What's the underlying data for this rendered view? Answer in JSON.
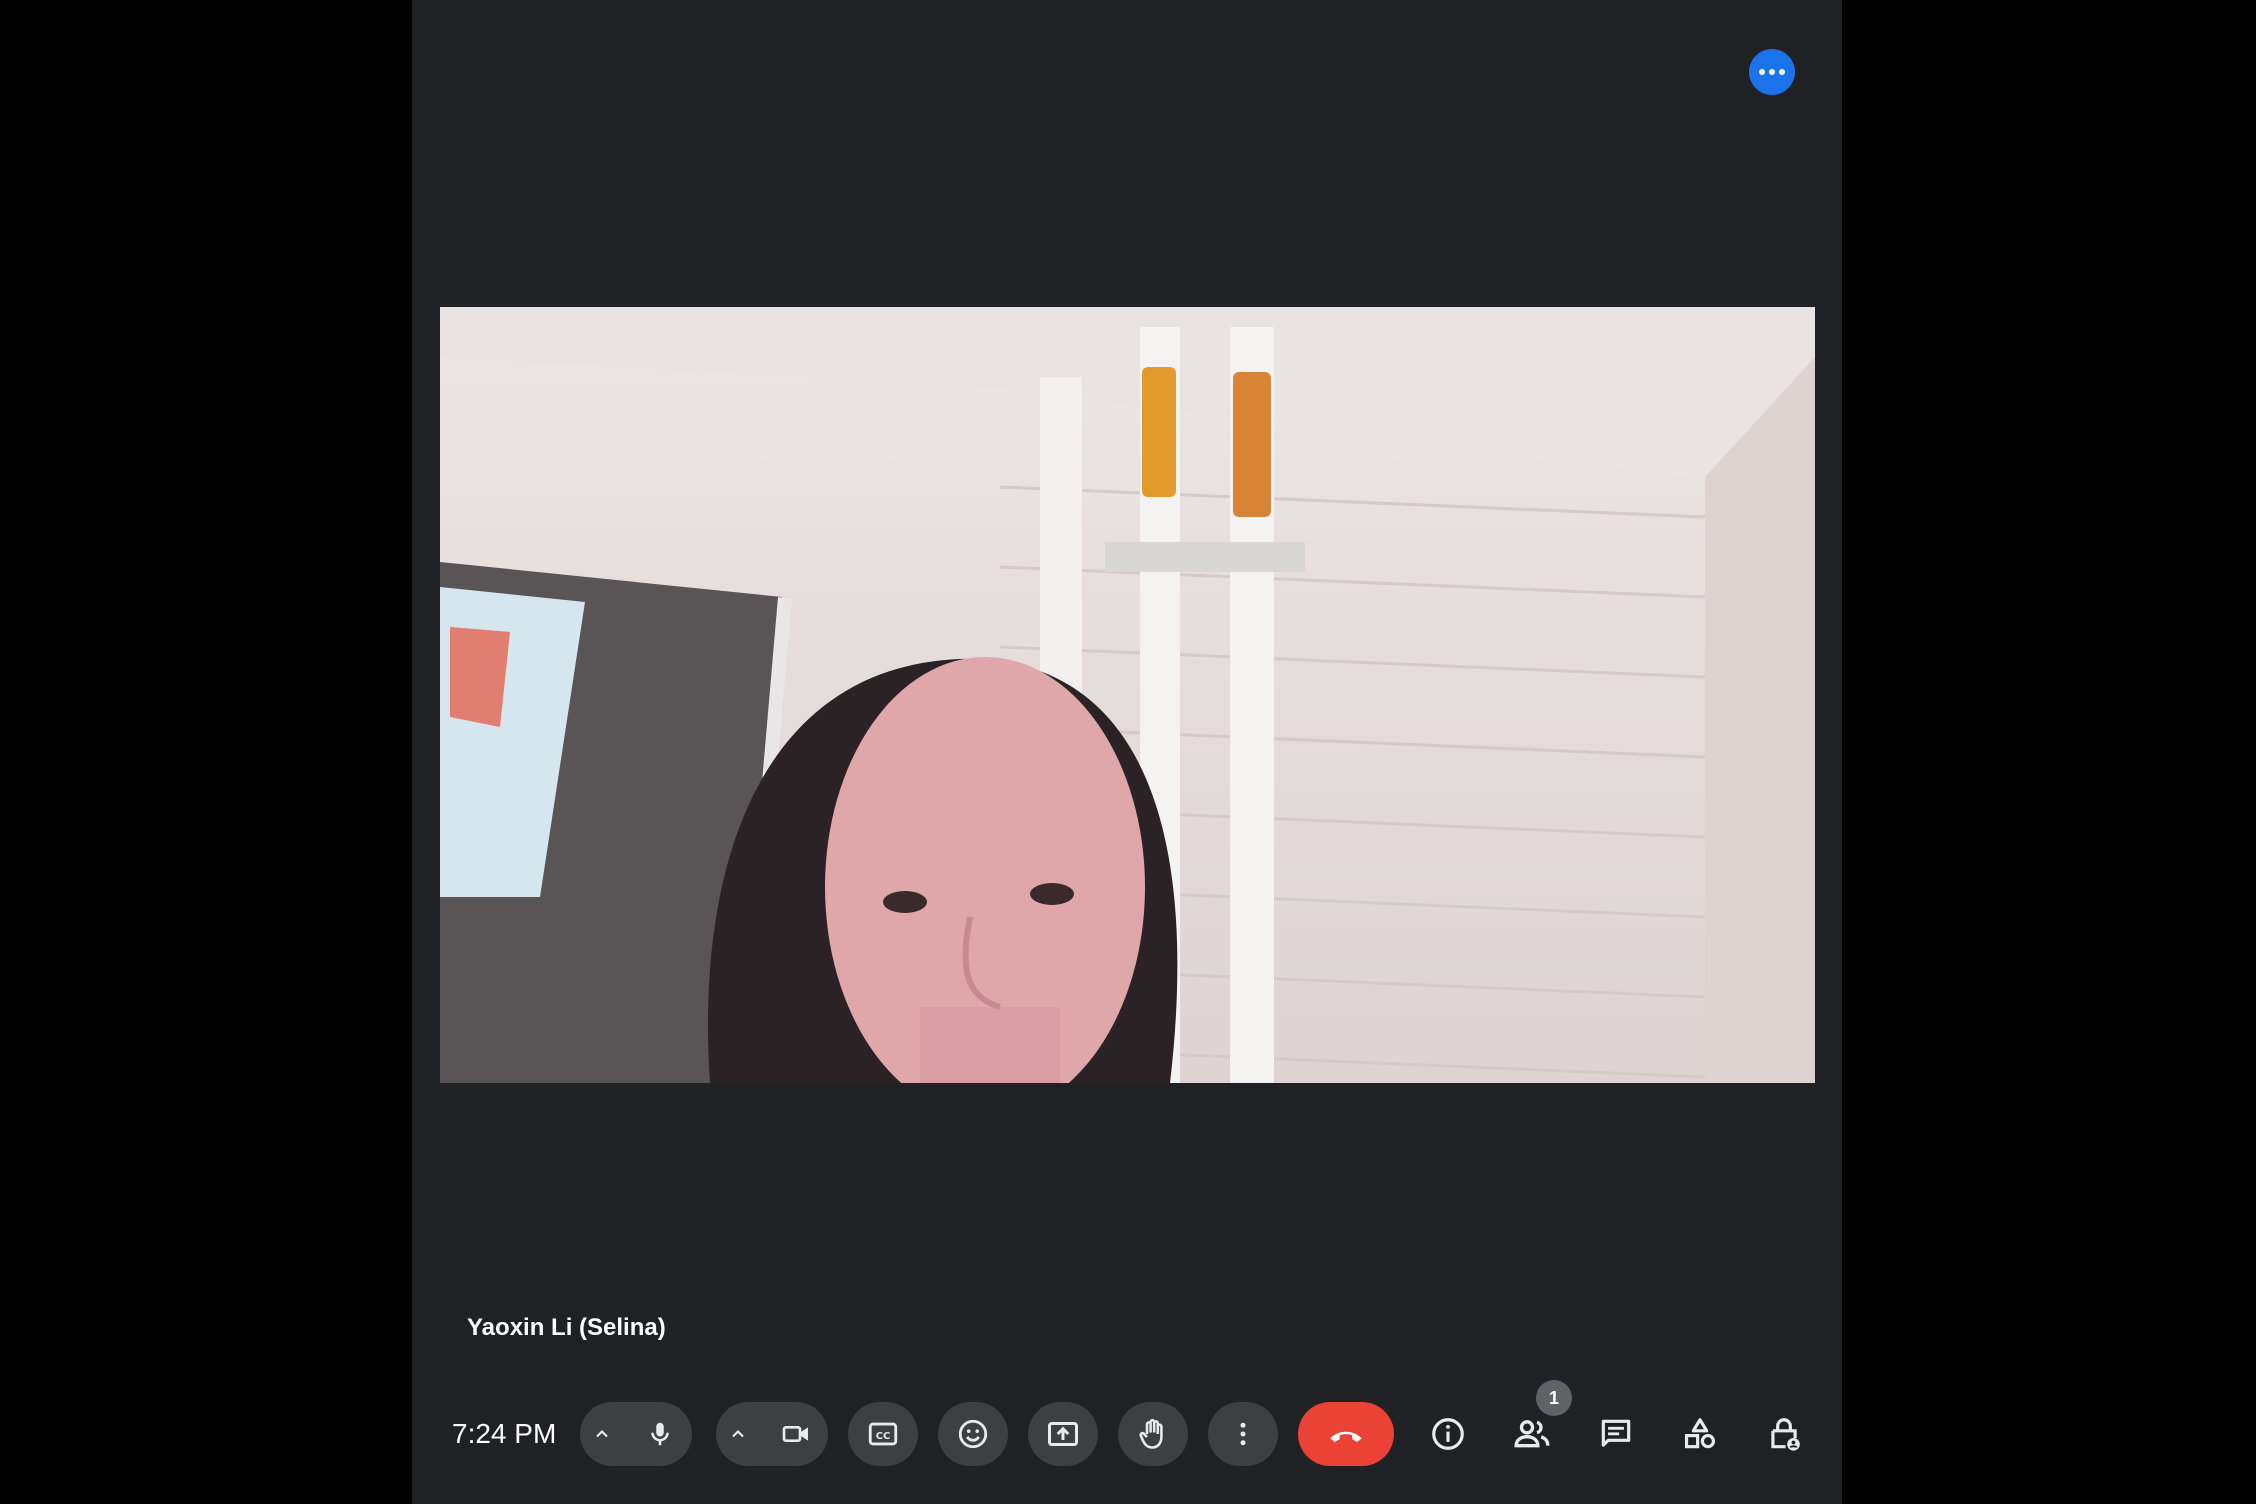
{
  "call": {
    "participant_name": "Yaoxin Li (Selina)",
    "time": "7:24 PM",
    "people_count": "1"
  },
  "controls": {
    "more_options_top": "more-options-icon",
    "audio_options": "chevron-up-icon",
    "microphone": "microphone-icon",
    "video_options": "chevron-up-icon",
    "camera": "camera-icon",
    "captions": "captions-icon",
    "reactions": "emoji-icon",
    "present": "present-screen-icon",
    "raise_hand": "raise-hand-icon",
    "more_options": "more-vert-icon",
    "leave_call": "call-end-icon",
    "meeting_details": "info-icon",
    "people": "people-icon",
    "chat": "chat-icon",
    "activities": "activities-icon",
    "host_controls": "host-controls-lock-icon"
  },
  "colors": {
    "panel_background": "#202124",
    "outer_background": "#000000",
    "button_background": "#3c4043",
    "end_call": "#ea4335",
    "accent_blue": "#1a73e8",
    "badge": "#5f6368"
  }
}
